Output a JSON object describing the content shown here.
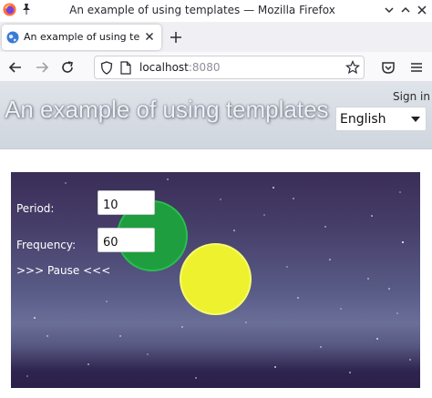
{
  "window": {
    "title": "An example of using templates — Mozilla Firefox"
  },
  "tab": {
    "title": "An example of using templates",
    "favicon": "globe-icon"
  },
  "navbar": {
    "url_host": "localhost",
    "url_port": ":8080"
  },
  "header": {
    "site_title": "An example of using templates",
    "sign_in": "Sign in",
    "language": "English"
  },
  "scene": {
    "period_label": "Period:",
    "period_value": "10",
    "frequency_label": "Frequency:",
    "frequency_value": "60",
    "pause_label": ">>> Pause <<<",
    "colors": {
      "green_ball": "#1e9e3e",
      "yellow_ball": "#eef22e",
      "sky_top": "#3a2e58",
      "sky_bottom": "#2a1f48"
    }
  }
}
